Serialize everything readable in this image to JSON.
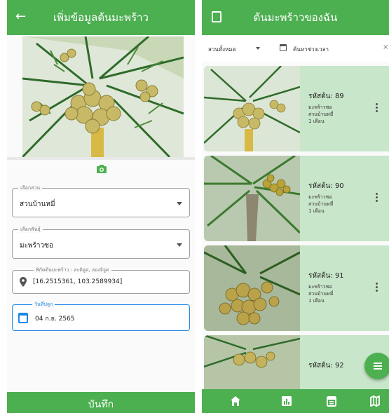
{
  "form_screen": {
    "title": "เพิ่มข้อมูลต้นมะพร้าว",
    "icons": {
      "back": "back-arrow-icon",
      "camera": "add-photo-icon"
    },
    "fields": {
      "garden": {
        "label": "เลือกสวน",
        "value": "สวนบ้านหมี่"
      },
      "variety": {
        "label": "เลือกพันธุ์",
        "value": "มะพร้าวซอ"
      },
      "location": {
        "label": "พิกัดต้นมะพร้าว : ละติจูด, ลองจิจูด",
        "value": "[16.2515361, 103.2589934]"
      },
      "planting_date": {
        "label": "วันที่ปลูก",
        "value": "04 ก.ย. 2565"
      }
    },
    "save_label": "บันทึก"
  },
  "list_screen": {
    "title": "ต้นมะพร้าวของฉัน",
    "filters": {
      "garden_filter": "สวนทั้งหมด",
      "date_filter": "ค้นหาช่วงเวลา",
      "clear": "×"
    },
    "cards": [
      {
        "tree_id": "รหัสต้น: 89",
        "variety": "มะพร้าวซอ",
        "garden": "สวนบ้านหมี่",
        "age": "1 เดือน"
      },
      {
        "tree_id": "รหัสต้น: 90",
        "variety": "มะพร้าวซอ",
        "garden": "สวนบ้านหมี่",
        "age": "1 เดือน"
      },
      {
        "tree_id": "รหัสต้น: 91",
        "variety": "มะพร้าวซอ",
        "garden": "สวนบ้านหมี่",
        "age": "1 เดือน"
      },
      {
        "tree_id": "รหัสต้น: 92"
      }
    ],
    "bottom_nav": [
      "home-icon",
      "chart-icon",
      "calendar-icon",
      "map-icon"
    ]
  },
  "colors": {
    "primary": "#4caf50",
    "card_bg": "#c8e6c9",
    "focus": "#1e88e5"
  }
}
